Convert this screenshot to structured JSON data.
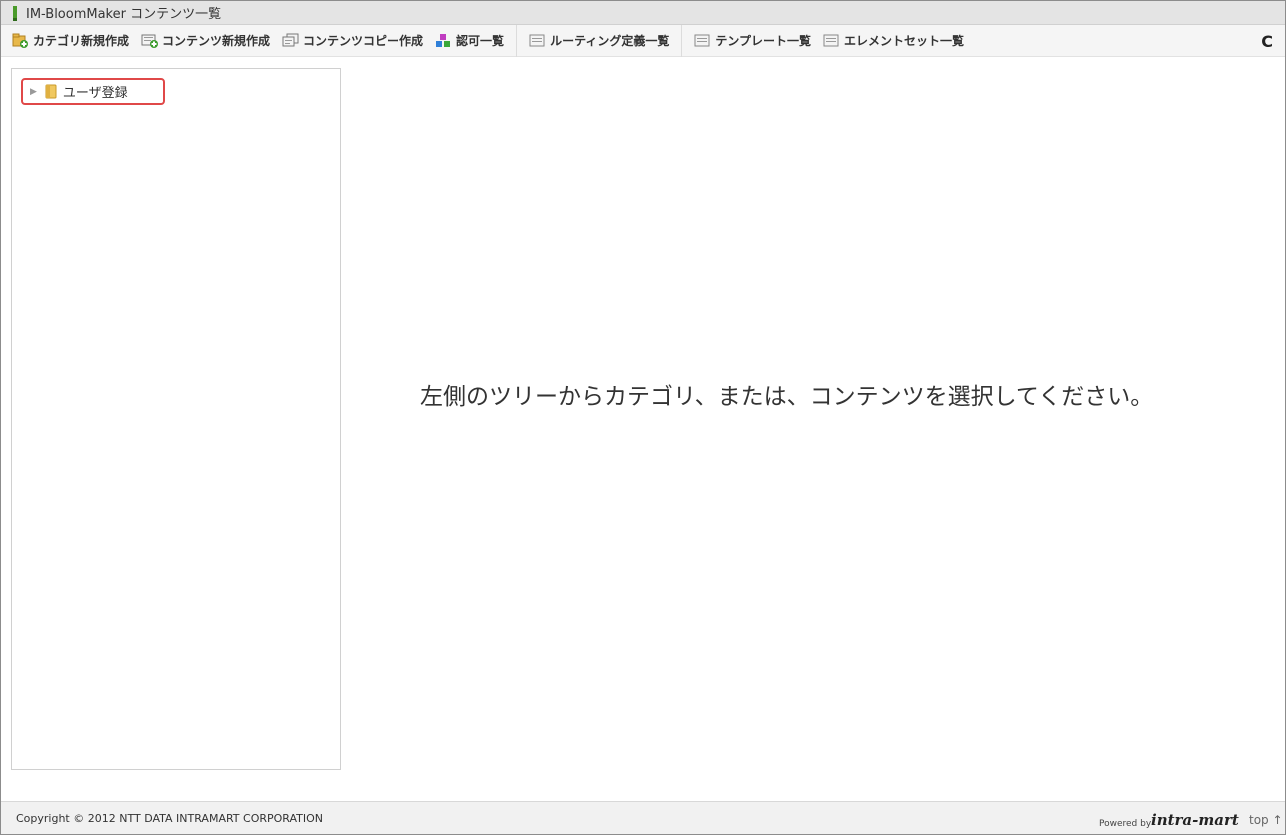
{
  "window": {
    "title": "IM-BloomMaker コンテンツ一覧"
  },
  "toolbar": {
    "items": [
      {
        "label": "カテゴリ新規作成",
        "icon": "category-add-icon"
      },
      {
        "label": "コンテンツ新規作成",
        "icon": "content-add-icon"
      },
      {
        "label": "コンテンツコピー作成",
        "icon": "content-copy-icon"
      },
      {
        "label": "認可一覧",
        "icon": "authorization-icon"
      },
      {
        "label": "ルーティング定義一覧",
        "icon": "list-icon"
      },
      {
        "label": "テンプレート一覧",
        "icon": "list-icon"
      },
      {
        "label": "エレメントセット一覧",
        "icon": "list-icon"
      }
    ],
    "refresh_icon": "refresh-icon",
    "refresh_glyph": "C"
  },
  "tree": {
    "nodes": [
      {
        "label": "ユーザ登録",
        "icon": "folder-icon",
        "expanded": false,
        "highlighted": true
      }
    ],
    "highlight_color": "#e04848"
  },
  "main": {
    "message": "左側のツリーからカテゴリ、または、コンテンツを選択してください。"
  },
  "footer": {
    "copyright": "Copyright © 2012 NTT DATA INTRAMART CORPORATION",
    "powered_by": "Powered by",
    "logo_text": "intra-mart",
    "top_link": "top ↑"
  }
}
